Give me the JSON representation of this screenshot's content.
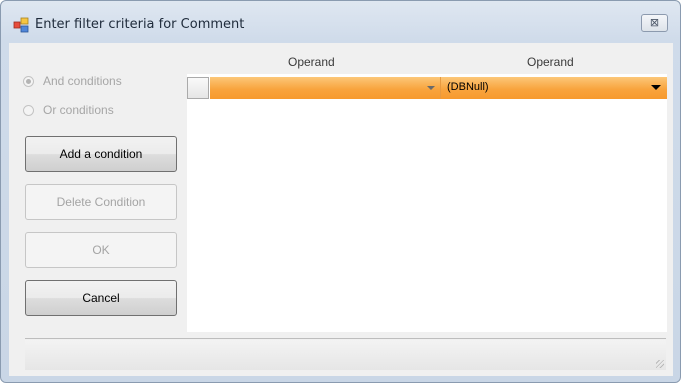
{
  "window": {
    "title": "Enter filter criteria for Comment",
    "close_glyph": "⊠"
  },
  "options": {
    "and_label": "And conditions",
    "or_label": "Or conditions",
    "selected": "and"
  },
  "buttons": {
    "add_condition": "Add a condition",
    "delete_condition": "Delete Condition",
    "ok": "OK",
    "cancel": "Cancel"
  },
  "grid": {
    "columns": [
      "Operand",
      "Operand"
    ],
    "rows": [
      {
        "operand1": "",
        "operand2": "(DBNull)"
      }
    ]
  },
  "colors": {
    "row_highlight": "#f8a43e",
    "disabled_text": "#a4a4a4"
  },
  "icons": {
    "app": "filter-icon",
    "close": "close-icon",
    "dropdown": "chevron-down-icon"
  }
}
